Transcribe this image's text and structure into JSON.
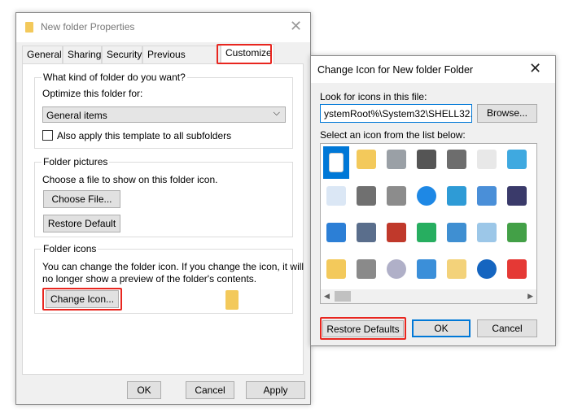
{
  "properties": {
    "title": "New folder Properties",
    "tabs": [
      {
        "label": "General"
      },
      {
        "label": "Sharing"
      },
      {
        "label": "Security"
      },
      {
        "label": "Previous Versions"
      },
      {
        "label": "Customize"
      }
    ],
    "active_tab": "Customize",
    "group1": {
      "label": "What kind of folder do you want?",
      "optimize_label": "Optimize this folder for:",
      "optimize_value": "General items",
      "checkbox_label": "Also apply this template to all subfolders",
      "checkbox_checked": false
    },
    "group2": {
      "label": "Folder pictures",
      "desc": "Choose a file to show on this folder icon.",
      "choose_file": "Choose File...",
      "restore_default": "Restore Default"
    },
    "group3": {
      "label": "Folder icons",
      "desc1": "You can change the folder icon. If you change the icon, it will",
      "desc2": "no longer show a preview of the folder's contents.",
      "change_icon": "Change Icon..."
    },
    "ok": "OK",
    "cancel": "Cancel",
    "apply": "Apply"
  },
  "change_icon": {
    "title": "Change Icon for New folder Folder",
    "look_label": "Look for icons in this file:",
    "file_value": "ystemRoot%\\System32\\SHELL32.dll",
    "browse": "Browse...",
    "select_label": "Select an icon from the list below:",
    "icons": [
      [
        "blank-file",
        "folder",
        "drive",
        "chip",
        "printer",
        "file-clock",
        "monitor-window"
      ],
      [
        "document",
        "network-drive",
        "drive-network",
        "globe",
        "monitor-globe",
        "control-panel",
        "projector"
      ],
      [
        "window",
        "floppy-drive",
        "drive-x",
        "globe-mouse",
        "network",
        "search",
        "green-arrow"
      ],
      [
        "folder",
        "drive-gray",
        "cd-drive",
        "laptop",
        "grid-folder",
        "help",
        "power"
      ]
    ],
    "restore_defaults": "Restore Defaults",
    "ok": "OK",
    "cancel": "Cancel"
  },
  "highlight_color": "#e8261f",
  "accent_color": "#0078d7"
}
